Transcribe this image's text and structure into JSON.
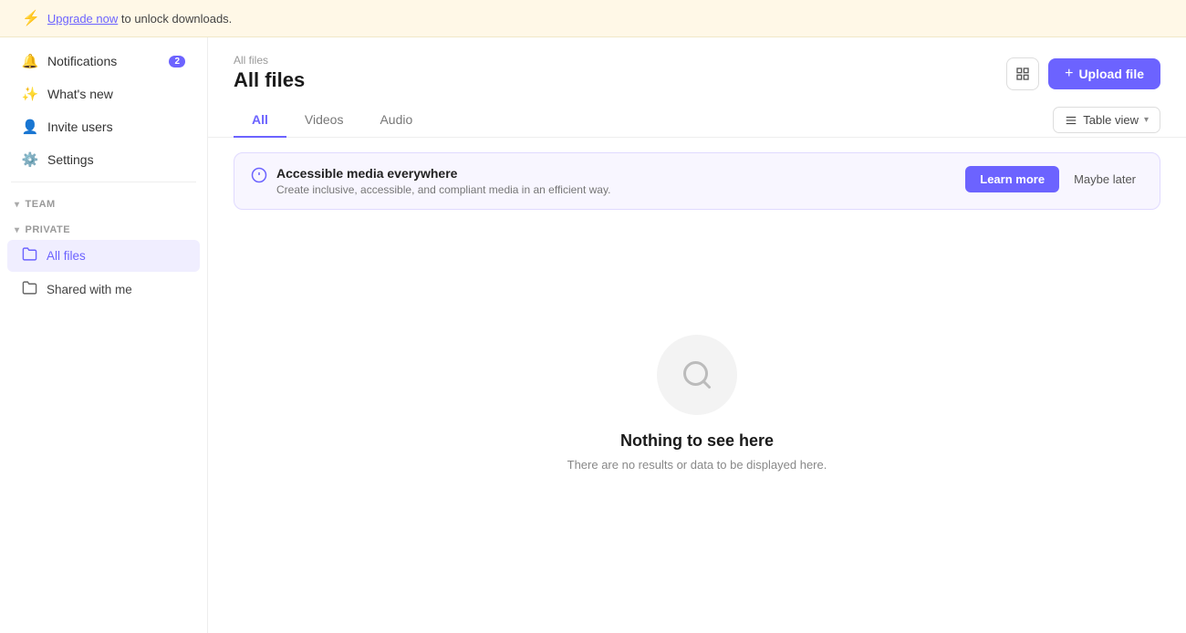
{
  "banner": {
    "text": "to unlock downloads.",
    "link_text": "Upgrade now",
    "lightning_icon": "⚡"
  },
  "sidebar": {
    "items": [
      {
        "id": "notifications",
        "label": "Notifications",
        "icon": "🔔",
        "badge": "2"
      },
      {
        "id": "whats-new",
        "label": "What's new",
        "icon": "✨",
        "badge": null
      },
      {
        "id": "invite-users",
        "label": "Invite users",
        "icon": "👤",
        "badge": null
      },
      {
        "id": "settings",
        "label": "Settings",
        "icon": "⚙️",
        "badge": null
      }
    ],
    "sections": [
      {
        "label": "TEAM",
        "items": []
      },
      {
        "label": "PRIVATE",
        "items": [
          {
            "id": "all-files",
            "label": "All files",
            "icon": "folder",
            "active": true
          },
          {
            "id": "shared-with-me",
            "label": "Shared with me",
            "icon": "folder-shared",
            "active": false
          }
        ]
      }
    ]
  },
  "header": {
    "breadcrumb": "All files",
    "title": "All files",
    "upload_button": "Upload file",
    "upload_icon": "+"
  },
  "tabs": {
    "items": [
      {
        "id": "all",
        "label": "All",
        "active": true
      },
      {
        "id": "videos",
        "label": "Videos",
        "active": false
      },
      {
        "id": "audio",
        "label": "Audio",
        "active": false
      }
    ],
    "view_button": "Table view"
  },
  "info_banner": {
    "title": "Accessible media everywhere",
    "description": "Create inclusive, accessible, and compliant media in an efficient way.",
    "learn_more": "Learn more",
    "maybe_later": "Maybe later"
  },
  "empty_state": {
    "title": "Nothing to see here",
    "description": "There are no results or data to be displayed here."
  }
}
